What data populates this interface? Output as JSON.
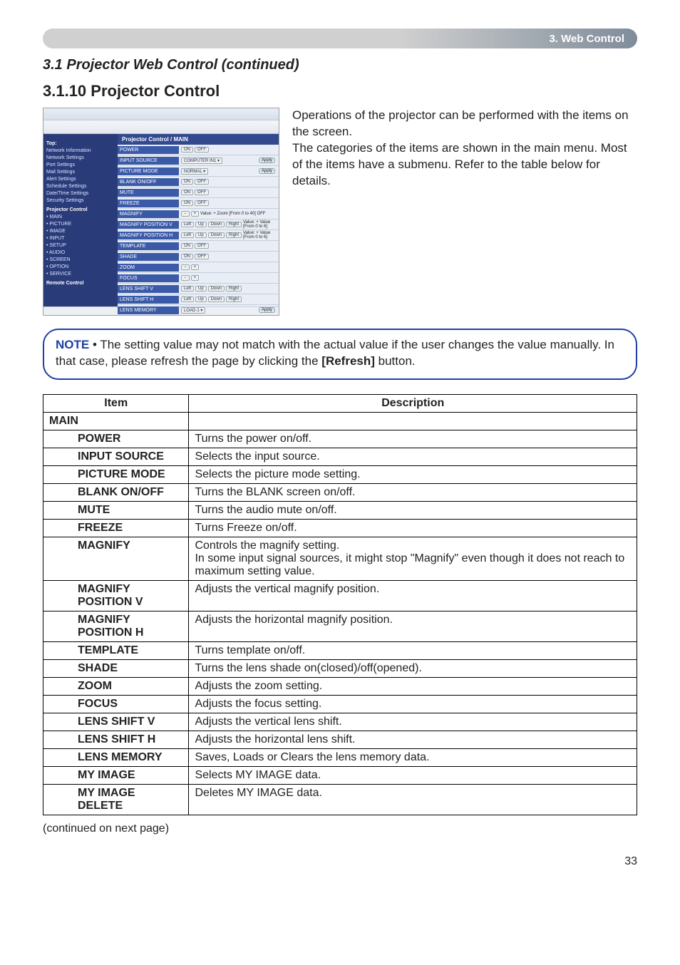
{
  "header": {
    "chapter": "3. Web Control"
  },
  "titles": {
    "continued": "3.1 Projector Web Control (continued)",
    "section": "3.1.10 Projector Control"
  },
  "paragraph": {
    "p1": "Operations of the projector can be performed with the items on the screen.",
    "p2": "The categories of the items are shown in the main menu. Most of the items have a submenu. Refer to the table below for details."
  },
  "note": {
    "label": "NOTE",
    "text_lead": "• The setting value may not match with the actual value if the user changes the value manually. In that case, please refresh the page by clicking the ",
    "refresh": "[Refresh]",
    "text_tail": " button."
  },
  "table": {
    "head_item": "Item",
    "head_desc": "Description",
    "category": "MAIN",
    "rows": [
      {
        "item": "POWER",
        "desc": "Turns the power on/off."
      },
      {
        "item": "INPUT SOURCE",
        "desc": "Selects the input source."
      },
      {
        "item": "PICTURE MODE",
        "desc": "Selects the picture mode setting."
      },
      {
        "item": "BLANK ON/OFF",
        "desc": "Turns the BLANK screen on/off."
      },
      {
        "item": "MUTE",
        "desc": "Turns the audio mute on/off."
      },
      {
        "item": "FREEZE",
        "desc": "Turns Freeze on/off."
      },
      {
        "item": "MAGNIFY",
        "desc": "Controls the magnify setting.\nIn some input signal sources, it might stop \"Magnify\" even though it does not reach to maximum setting value."
      },
      {
        "item": "MAGNIFY POSITION V",
        "desc": "Adjusts the vertical magnify position."
      },
      {
        "item": "MAGNIFY POSITION H",
        "desc": "Adjusts the horizontal magnify position."
      },
      {
        "item": "TEMPLATE",
        "desc": "Turns template on/off."
      },
      {
        "item": "SHADE",
        "desc": "Turns the lens shade on(closed)/off(opened)."
      },
      {
        "item": "ZOOM",
        "desc": "Adjusts the zoom setting."
      },
      {
        "item": "FOCUS",
        "desc": "Adjusts the focus setting."
      },
      {
        "item": "LENS SHIFT V",
        "desc": "Adjusts the vertical lens shift."
      },
      {
        "item": "LENS SHIFT H",
        "desc": "Adjusts the horizontal lens shift."
      },
      {
        "item": "LENS MEMORY",
        "desc": "Saves, Loads or Clears the lens memory data."
      },
      {
        "item": "MY IMAGE",
        "desc": "Selects MY IMAGE data."
      },
      {
        "item": "MY IMAGE DELETE",
        "desc": "Deletes MY IMAGE data."
      }
    ]
  },
  "continued_note": "(continued on next page)",
  "page_number": "33",
  "screenshot": {
    "panel_title": "Projector Control / MAIN",
    "side": {
      "top": "Top:",
      "items": [
        "Network Information",
        "Network Settings",
        "Port Settings",
        "Mail Settings",
        "Alert Settings",
        "Schedule Settings",
        "Date/Time Settings",
        "Security Settings"
      ],
      "pc_header": "Projector Control",
      "pc_items": [
        "MAIN",
        "PICTURE",
        "IMAGE",
        "INPUT",
        "SETUP",
        "AUDIO",
        "SCREEN",
        "OPTION",
        "SERVICE"
      ],
      "remote": "Remote Control"
    },
    "rows": [
      {
        "label": "POWER",
        "ctrl": "onoff",
        "apply": false
      },
      {
        "label": "INPUT SOURCE",
        "ctrl": "select",
        "sel": "COMPUTER IN1",
        "apply": true
      },
      {
        "label": "PICTURE MODE",
        "ctrl": "select",
        "sel": "NORMAL",
        "apply": true
      },
      {
        "label": "BLANK ON/OFF",
        "ctrl": "onoff",
        "apply": false
      },
      {
        "label": "MUTE",
        "ctrl": "onoff",
        "apply": false
      },
      {
        "label": "FREEZE",
        "ctrl": "onoff",
        "apply": false
      },
      {
        "label": "MAGNIFY",
        "ctrl": "plusminus",
        "extra": "Value: +  Zoom  [From 0 to 40]  OFF",
        "apply": false
      },
      {
        "label": "MAGNIFY POSITION V",
        "ctrl": "arrows",
        "extra": "Value: +  Value  [From 0 to 6]",
        "apply": false
      },
      {
        "label": "MAGNIFY POSITION H",
        "ctrl": "arrows",
        "extra": "Value: +  Value  [From 0 to 6]",
        "apply": false
      },
      {
        "label": "TEMPLATE",
        "ctrl": "onoff",
        "apply": false
      },
      {
        "label": "SHADE",
        "ctrl": "onoff",
        "apply": false
      },
      {
        "label": "ZOOM",
        "ctrl": "plusminus",
        "apply": false
      },
      {
        "label": "FOCUS",
        "ctrl": "plusminus",
        "apply": false
      },
      {
        "label": "LENS SHIFT V",
        "ctrl": "arrows",
        "apply": false
      },
      {
        "label": "LENS SHIFT H",
        "ctrl": "arrows",
        "apply": false
      },
      {
        "label": "LENS MEMORY",
        "ctrl": "select",
        "sel": "LOAD-1",
        "apply": true
      }
    ],
    "btn_on": "ON",
    "btn_off": "OFF",
    "btn_apply": "Apply",
    "btn_plus": "+",
    "btn_minus": "−",
    "btn_left": "Left",
    "btn_right": "Right",
    "btn_up": "Up",
    "btn_down": "Down"
  }
}
